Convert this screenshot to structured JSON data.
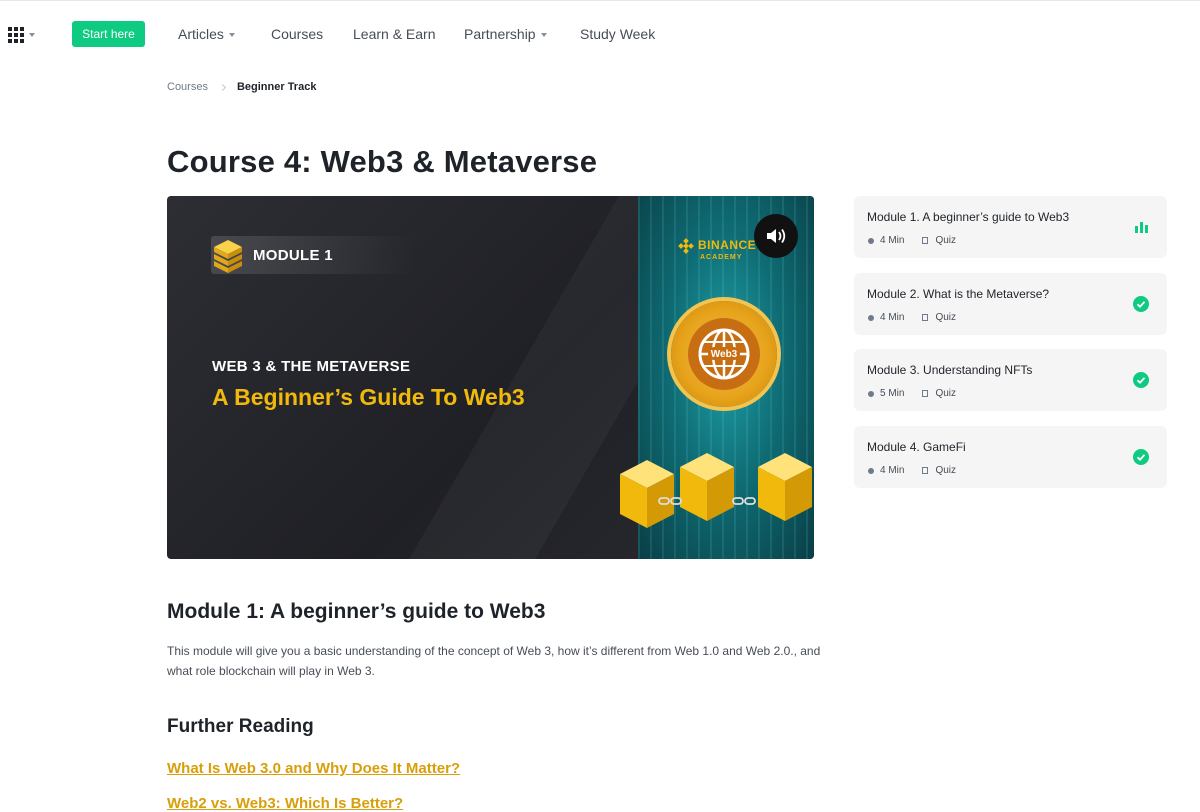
{
  "nav": {
    "start_label": "Start here",
    "links": [
      {
        "label": "Articles",
        "has_caret": true
      },
      {
        "label": "Courses",
        "has_caret": false
      },
      {
        "label": "Learn & Earn",
        "has_caret": false
      },
      {
        "label": "Partnership",
        "has_caret": true
      },
      {
        "label": "Study Week",
        "has_caret": false
      }
    ],
    "accent_color": "#0ecb81"
  },
  "breadcrumb": {
    "parent": "Courses",
    "current": "Beginner Track"
  },
  "page": {
    "title": "Course 4: Web3 & Metaverse"
  },
  "video": {
    "module_tag": "MODULE 1",
    "subtitle": "WEB 3 & THE METAVERSE",
    "headline": "A Beginner’s Guide To Web3",
    "brand": "BINANCE",
    "brand_sub": "ACADEMY",
    "coin_label": "Web3",
    "speaker_icon": "speaker-icon"
  },
  "modules": [
    {
      "title": "Module 1. A beginner’s guide to Web3",
      "duration": "4 Min",
      "quiz": "Quiz",
      "status": "in-progress"
    },
    {
      "title": "Module 2. What is the Metaverse?",
      "duration": "4 Min",
      "quiz": "Quiz",
      "status": "complete"
    },
    {
      "title": "Module 3. Understanding NFTs",
      "duration": "5 Min",
      "quiz": "Quiz",
      "status": "complete"
    },
    {
      "title": "Module 4. GameFi",
      "duration": "4 Min",
      "quiz": "Quiz",
      "status": "complete"
    }
  ],
  "content": {
    "heading": "Module 1: A beginner’s guide to Web3",
    "description": "This module will give you a basic understanding of the concept of Web 3, how it’s different from Web 1.0 and Web 2.0., and what role blockchain will play in Web 3.",
    "further_reading": "Further Reading",
    "links": [
      "What Is Web 3.0 and Why Does It Matter?",
      "Web2 vs. Web3: Which Is Better?"
    ]
  },
  "colors": {
    "status_green": "#0ecb81",
    "link_gold": "#d89f0a",
    "brand_yellow": "#f0b90b"
  }
}
